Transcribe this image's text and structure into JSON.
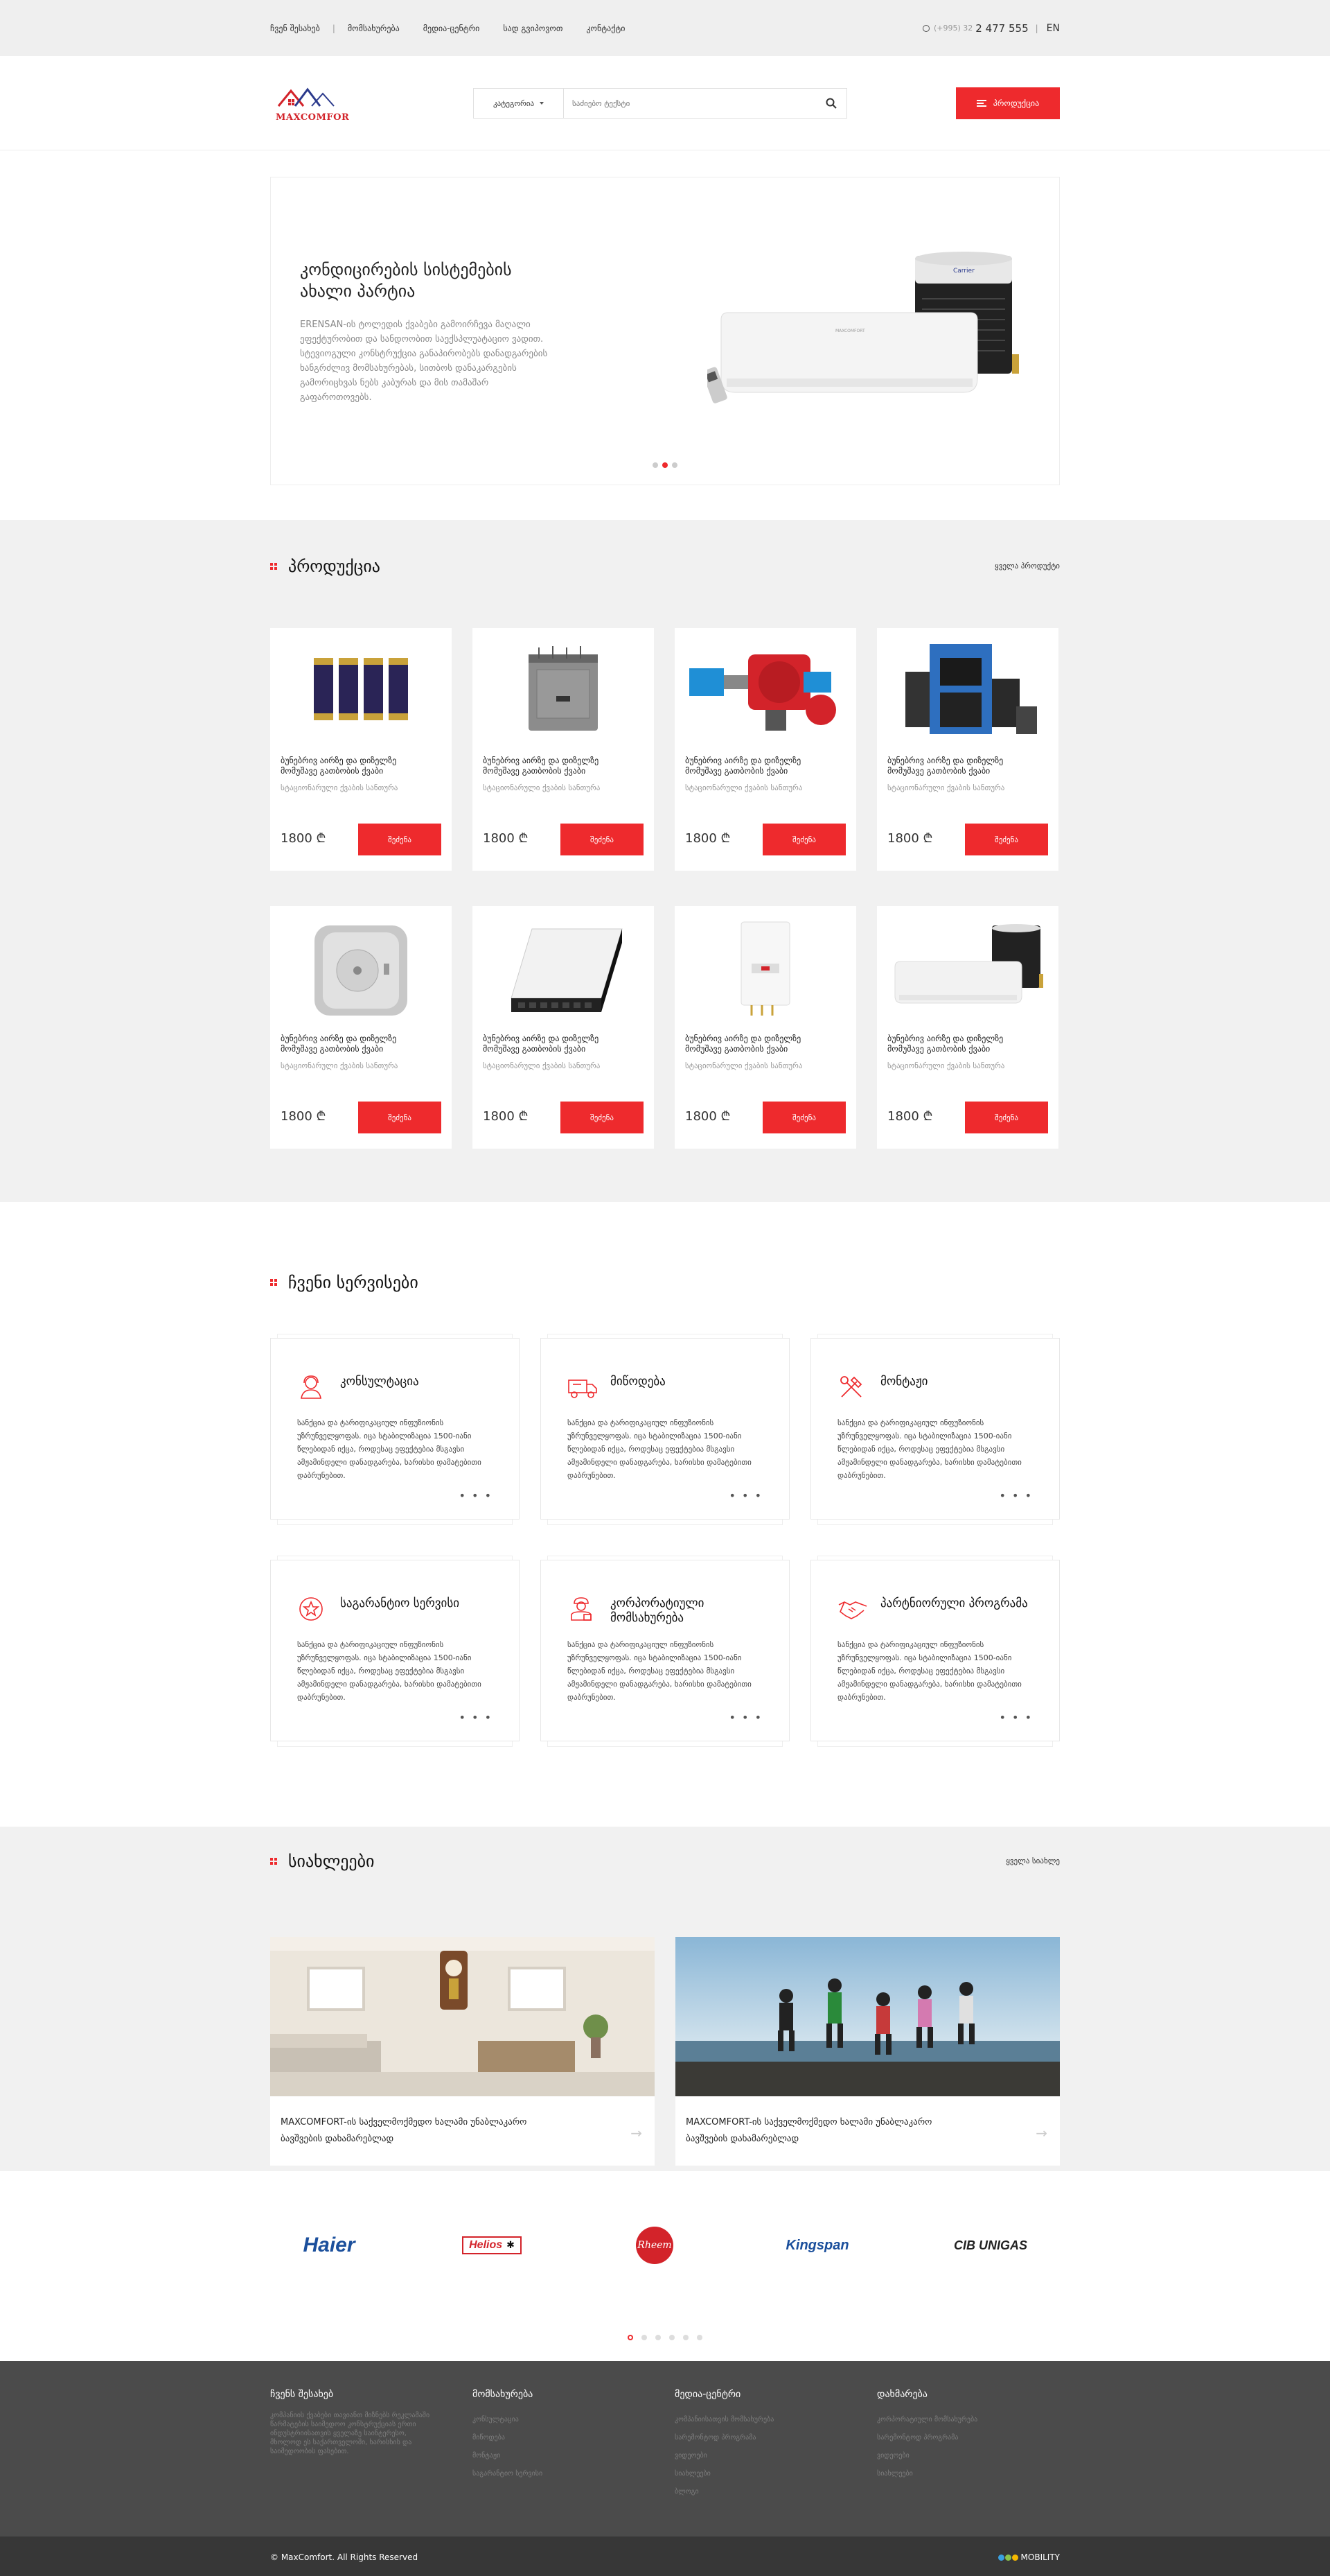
{
  "topbar": {
    "nav": [
      "ჩვენ შესახებ",
      "მომსახურება",
      "მედია-ცენტრი",
      "სად გვიპოვოთ",
      "კონტაქტი"
    ],
    "phone_code": "(+995) 32",
    "phone_number": "2 477 555",
    "lang": "EN"
  },
  "header": {
    "logo_text": "MAXCOMFOR",
    "search_category": "კატეგორია",
    "search_placeholder": "საძიებო ტექსტი",
    "products_button": "პროდუქცია"
  },
  "hero": {
    "title": "კონდიცირების სისტემების ახალი პარტია",
    "text": "ERENSAN-ის ტოლედის ქვაბები გამოირჩევა მაღალი ეფექტურობით და სანდოობით საექსპლუატაციო ვადით. სტევიოგული კონსტრუქცია განაპირობებს დანადგარების ხანგრძლივ მომსახურებას, სითბოს დანაკარგების გამორიცხვას ნებს კაბურას და მის თამაშარ გაფაროთოვებს.",
    "dots": 3,
    "active_dot": 1
  },
  "products": {
    "title": "პროდუქცია",
    "view_all": "ყველა პროდუქტი",
    "items": [
      {
        "name": "ბუნებრივ აირზე და დიზელზე მომუშავე გათბობის ქვაბი",
        "sub": "სტაციონარული ქვაბის სანთურა",
        "price": "1800 ₾",
        "button": "შეძენა",
        "image": "cylinders"
      },
      {
        "name": "ბუნებრივ აირზე და დიზელზე მომუშავე გათბობის ქვაბი",
        "sub": "სტაციონარული ქვაბის სანთურა",
        "price": "1800 ₾",
        "button": "შეძენა",
        "image": "sauna-heater"
      },
      {
        "name": "ბუნებრივ აირზე და დიზელზე მომუშავე გათბობის ქვაბი",
        "sub": "სტაციონარული ქვაბის სანთურა",
        "price": "1800 ₾",
        "button": "შეძენა",
        "image": "burner"
      },
      {
        "name": "ბუნებრივ აირზე და დიზელზე მომუშავე გათბობის ქვაბი",
        "sub": "სტაციონარული ქვაბის სანთურა",
        "price": "1800 ₾",
        "button": "შეძენა",
        "image": "boiler"
      },
      {
        "name": "ბუნებრივ აირზე და დიზელზე მომუშავე გათბობის ქვაბი",
        "sub": "სტაციონარული ქვაბის სანთურა",
        "price": "1800 ₾",
        "button": "შეძენა",
        "image": "thermostat"
      },
      {
        "name": "ბუნებრივ აირზე და დიზელზე მომუშავე გათბობის ქვაბი",
        "sub": "სტაციონარული ქვაბის სანთურა",
        "price": "1800 ₾",
        "button": "შეძენა",
        "image": "convector"
      },
      {
        "name": "ბუნებრივ აირზე და დიზელზე მომუშავე გათბობის ქვაბი",
        "sub": "სტაციონარული ქვაბის სანთურა",
        "price": "1800 ₾",
        "button": "შეძენა",
        "image": "gas-boiler"
      },
      {
        "name": "ბუნებრივ აირზე და დიზელზე მომუშავე გათბობის ქვაბი",
        "sub": "სტაციონარული ქვაბის სანთურა",
        "price": "1800 ₾",
        "button": "შეძენა",
        "image": "air-conditioner"
      }
    ]
  },
  "services": {
    "title": "ჩვენი სერვისები",
    "more": "• • •",
    "items": [
      {
        "title": "კონსულტაცია",
        "icon": "consultant-icon",
        "text": "სანქცია და ტარიფიკაციულ ინფუზიონის უზრუნველყოფას. იცა სტაბილიზაცია 1500-იანი წლებიდან იქცა, როდესაც ეფექტებია მსგავსი ამჟამინდელი დანადგარება, ხარისხი დამატებითი დაბრუნებით."
      },
      {
        "title": "მიწოდება",
        "icon": "delivery-truck-icon",
        "text": "სანქცია და ტარიფიკაციულ ინფუზიონის უზრუნველყოფას. იცა სტაბილიზაცია 1500-იანი წლებიდან იქცა, როდესაც ეფექტებია მსგავსი ამჟამინდელი დანადგარება, ხარისხი დამატებითი დაბრუნებით."
      },
      {
        "title": "მონტაჟი",
        "icon": "tools-icon",
        "text": "სანქცია და ტარიფიკაციულ ინფუზიონის უზრუნველყოფას. იცა სტაბილიზაცია 1500-იანი წლებიდან იქცა, როდესაც ეფექტებია მსგავსი ამჟამინდელი დანადგარება, ხარისხი დამატებითი დაბრუნებით."
      },
      {
        "title": "საგარანტიო სერვისი",
        "icon": "warranty-badge-icon",
        "text": "სანქცია და ტარიფიკაციულ ინფუზიონის უზრუნველყოფას. იცა სტაბილიზაცია 1500-იანი წლებიდან იქცა, როდესაც ეფექტებია მსგავსი ამჟამინდელი დანადგარება, ხარისხი დამატებითი დაბრუნებით."
      },
      {
        "title": "კორპორატიული მომსახურება",
        "icon": "worker-icon",
        "text": "სანქცია და ტარიფიკაციულ ინფუზიონის უზრუნველყოფას. იცა სტაბილიზაცია 1500-იანი წლებიდან იქცა, როდესაც ეფექტებია მსგავსი ამჟამინდელი დანადგარება, ხარისხი დამატებითი დაბრუნებით."
      },
      {
        "title": "პარტნიორული პროგრამა",
        "icon": "handshake-icon",
        "text": "სანქცია და ტარიფიკაციულ ინფუზიონის უზრუნველყოფას. იცა სტაბილიზაცია 1500-იანი წლებიდან იქცა, როდესაც ეფექტებია მსგავსი ამჟამინდელი დანადგარება, ხარისხი დამატებითი დაბრუნებით."
      }
    ]
  },
  "news": {
    "title": "სიახლეები",
    "view_all": "ყველა სიახლე",
    "items": [
      {
        "text": "MAXCOMFORT-ის საქველმოქმედო ხალამი უნაბლაკარო ბავშვების დახამარებლად",
        "image": "living-room-photo"
      },
      {
        "text": "MAXCOMFORT-ის საქველმოქმედო ხალამი უნაბლაკარო ბავშვების დახამარებლად",
        "image": "children-beach-photo"
      }
    ]
  },
  "brands": {
    "items": [
      {
        "name": "Haier",
        "color": "#1b4f9c"
      },
      {
        "name": "Helios",
        "color": "#d3232a"
      },
      {
        "name": "Rheem",
        "color": "#d3232a"
      },
      {
        "name": "Kingspan",
        "color": "#1b4f9c"
      },
      {
        "name": "CIB UNIGAS",
        "color": "#d3232a"
      }
    ],
    "dots": 6,
    "active_dot": 0
  },
  "footer": {
    "cols": [
      {
        "head": "ჩვენს შესახებ",
        "text": "კომპანიის ქვაბები თავიანთ მიზნებს რეკლამაში წარმატების საიმედოო კონსტრუქციას ერთი ინდუსტრიისათვის ყველაზე საინტერესო, მხოლოდ ეს საქართველოში, ხარისხის და საიმედოობის ფასებით."
      },
      {
        "head": "მომსახურება",
        "links": [
          "კონსულტაცია",
          "მიწოდება",
          "მონტაჟი",
          "საგარანტიო სერვისი"
        ]
      },
      {
        "head": "მედია-ცენტრი",
        "links": [
          "კომპანიისათვის მომსახურება",
          "სარემონტოდ პროგრამა",
          "ვიდეოები",
          "სიახლეები",
          "ბლოგი"
        ]
      },
      {
        "head": "დახმარება",
        "links": [
          "კორპორატიული მომსახურება",
          "სარემონტოდ პროგრამა",
          "ვიდეოები",
          "სიახლეები"
        ]
      }
    ],
    "copyright": "© MaxComfort. All Rights Reserved",
    "credit": "MOBILITY"
  },
  "colors": {
    "accent": "#ee2a2d",
    "footer": "#4b4b4b",
    "footer_bottom": "#373737",
    "section_bg": "#f1f1f1"
  }
}
